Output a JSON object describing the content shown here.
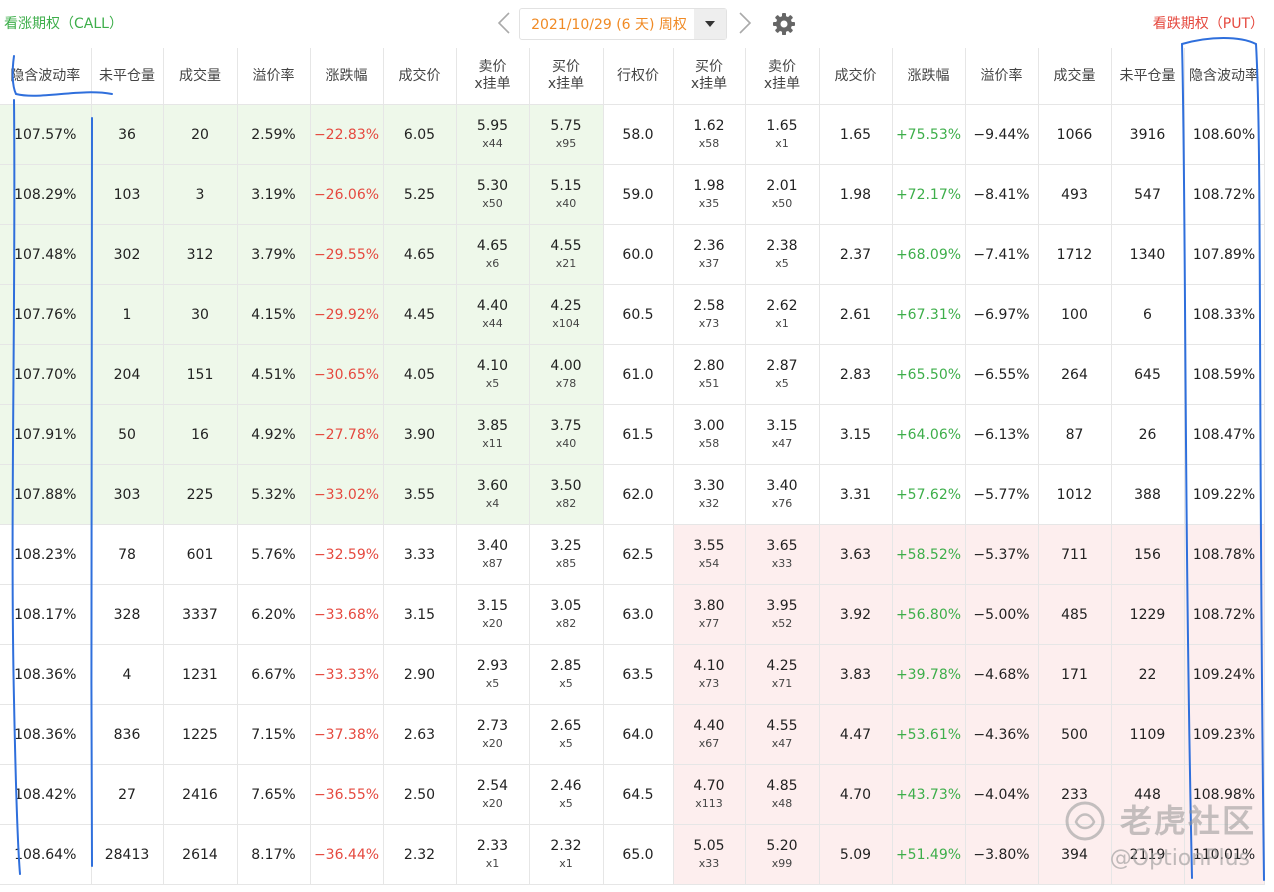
{
  "call_title": "看涨期权（CALL）",
  "put_title": "看跌期权（PUT）",
  "expiry": {
    "selected": "2021/10/29 (6 天) 周权"
  },
  "headers": [
    "隐含波动率",
    "未平仓量",
    "成交量",
    "溢价率",
    "涨跌幅",
    "成交价",
    "卖价\nx挂单",
    "买价\nx挂单",
    "行权价",
    "买价\nx挂单",
    "卖价\nx挂单",
    "成交价",
    "涨跌幅",
    "溢价率",
    "成交量",
    "未平仓量",
    "隐含波动率"
  ],
  "rows": [
    {
      "c_iv": "107.57%",
      "c_oi": "36",
      "c_vol": "20",
      "c_prem": "2.59%",
      "c_chg": "−22.83%",
      "c_last": "6.05",
      "c_ask": "5.95",
      "c_askq": "x44",
      "c_bid": "5.75",
      "c_bidq": "x95",
      "strike": "58.0",
      "p_bid": "1.62",
      "p_bidq": "x58",
      "p_ask": "1.65",
      "p_askq": "x1",
      "p_last": "1.65",
      "p_chg": "+75.53%",
      "p_prem": "−9.44%",
      "p_vol": "1066",
      "p_oi": "3916",
      "p_iv": "108.60%",
      "call_itm": true,
      "put_itm": false
    },
    {
      "c_iv": "108.29%",
      "c_oi": "103",
      "c_vol": "3",
      "c_prem": "3.19%",
      "c_chg": "−26.06%",
      "c_last": "5.25",
      "c_ask": "5.30",
      "c_askq": "x50",
      "c_bid": "5.15",
      "c_bidq": "x40",
      "strike": "59.0",
      "p_bid": "1.98",
      "p_bidq": "x35",
      "p_ask": "2.01",
      "p_askq": "x50",
      "p_last": "1.98",
      "p_chg": "+72.17%",
      "p_prem": "−8.41%",
      "p_vol": "493",
      "p_oi": "547",
      "p_iv": "108.72%",
      "call_itm": true,
      "put_itm": false
    },
    {
      "c_iv": "107.48%",
      "c_oi": "302",
      "c_vol": "312",
      "c_prem": "3.79%",
      "c_chg": "−29.55%",
      "c_last": "4.65",
      "c_ask": "4.65",
      "c_askq": "x6",
      "c_bid": "4.55",
      "c_bidq": "x21",
      "strike": "60.0",
      "p_bid": "2.36",
      "p_bidq": "x37",
      "p_ask": "2.38",
      "p_askq": "x5",
      "p_last": "2.37",
      "p_chg": "+68.09%",
      "p_prem": "−7.41%",
      "p_vol": "1712",
      "p_oi": "1340",
      "p_iv": "107.89%",
      "call_itm": true,
      "put_itm": false
    },
    {
      "c_iv": "107.76%",
      "c_oi": "1",
      "c_vol": "30",
      "c_prem": "4.15%",
      "c_chg": "−29.92%",
      "c_last": "4.45",
      "c_ask": "4.40",
      "c_askq": "x44",
      "c_bid": "4.25",
      "c_bidq": "x104",
      "strike": "60.5",
      "p_bid": "2.58",
      "p_bidq": "x73",
      "p_ask": "2.62",
      "p_askq": "x1",
      "p_last": "2.61",
      "p_chg": "+67.31%",
      "p_prem": "−6.97%",
      "p_vol": "100",
      "p_oi": "6",
      "p_iv": "108.33%",
      "call_itm": true,
      "put_itm": false
    },
    {
      "c_iv": "107.70%",
      "c_oi": "204",
      "c_vol": "151",
      "c_prem": "4.51%",
      "c_chg": "−30.65%",
      "c_last": "4.05",
      "c_ask": "4.10",
      "c_askq": "x5",
      "c_bid": "4.00",
      "c_bidq": "x78",
      "strike": "61.0",
      "p_bid": "2.80",
      "p_bidq": "x51",
      "p_ask": "2.87",
      "p_askq": "x5",
      "p_last": "2.83",
      "p_chg": "+65.50%",
      "p_prem": "−6.55%",
      "p_vol": "264",
      "p_oi": "645",
      "p_iv": "108.59%",
      "call_itm": true,
      "put_itm": false
    },
    {
      "c_iv": "107.91%",
      "c_oi": "50",
      "c_vol": "16",
      "c_prem": "4.92%",
      "c_chg": "−27.78%",
      "c_last": "3.90",
      "c_ask": "3.85",
      "c_askq": "x11",
      "c_bid": "3.75",
      "c_bidq": "x40",
      "strike": "61.5",
      "p_bid": "3.00",
      "p_bidq": "x58",
      "p_ask": "3.15",
      "p_askq": "x47",
      "p_last": "3.15",
      "p_chg": "+64.06%",
      "p_prem": "−6.13%",
      "p_vol": "87",
      "p_oi": "26",
      "p_iv": "108.47%",
      "call_itm": true,
      "put_itm": false
    },
    {
      "c_iv": "107.88%",
      "c_oi": "303",
      "c_vol": "225",
      "c_prem": "5.32%",
      "c_chg": "−33.02%",
      "c_last": "3.55",
      "c_ask": "3.60",
      "c_askq": "x4",
      "c_bid": "3.50",
      "c_bidq": "x82",
      "strike": "62.0",
      "p_bid": "3.30",
      "p_bidq": "x32",
      "p_ask": "3.40",
      "p_askq": "x76",
      "p_last": "3.31",
      "p_chg": "+57.62%",
      "p_prem": "−5.77%",
      "p_vol": "1012",
      "p_oi": "388",
      "p_iv": "109.22%",
      "call_itm": true,
      "put_itm": false
    },
    {
      "c_iv": "108.23%",
      "c_oi": "78",
      "c_vol": "601",
      "c_prem": "5.76%",
      "c_chg": "−32.59%",
      "c_last": "3.33",
      "c_ask": "3.40",
      "c_askq": "x87",
      "c_bid": "3.25",
      "c_bidq": "x85",
      "strike": "62.5",
      "p_bid": "3.55",
      "p_bidq": "x54",
      "p_ask": "3.65",
      "p_askq": "x33",
      "p_last": "3.63",
      "p_chg": "+58.52%",
      "p_prem": "−5.37%",
      "p_vol": "711",
      "p_oi": "156",
      "p_iv": "108.78%",
      "call_itm": false,
      "put_itm": true
    },
    {
      "c_iv": "108.17%",
      "c_oi": "328",
      "c_vol": "3337",
      "c_prem": "6.20%",
      "c_chg": "−33.68%",
      "c_last": "3.15",
      "c_ask": "3.15",
      "c_askq": "x20",
      "c_bid": "3.05",
      "c_bidq": "x82",
      "strike": "63.0",
      "p_bid": "3.80",
      "p_bidq": "x77",
      "p_ask": "3.95",
      "p_askq": "x52",
      "p_last": "3.92",
      "p_chg": "+56.80%",
      "p_prem": "−5.00%",
      "p_vol": "485",
      "p_oi": "1229",
      "p_iv": "108.72%",
      "call_itm": false,
      "put_itm": true
    },
    {
      "c_iv": "108.36%",
      "c_oi": "4",
      "c_vol": "1231",
      "c_prem": "6.67%",
      "c_chg": "−33.33%",
      "c_last": "2.90",
      "c_ask": "2.93",
      "c_askq": "x5",
      "c_bid": "2.85",
      "c_bidq": "x5",
      "strike": "63.5",
      "p_bid": "4.10",
      "p_bidq": "x73",
      "p_ask": "4.25",
      "p_askq": "x71",
      "p_last": "3.83",
      "p_chg": "+39.78%",
      "p_prem": "−4.68%",
      "p_vol": "171",
      "p_oi": "22",
      "p_iv": "109.24%",
      "call_itm": false,
      "put_itm": true
    },
    {
      "c_iv": "108.36%",
      "c_oi": "836",
      "c_vol": "1225",
      "c_prem": "7.15%",
      "c_chg": "−37.38%",
      "c_last": "2.63",
      "c_ask": "2.73",
      "c_askq": "x20",
      "c_bid": "2.65",
      "c_bidq": "x5",
      "strike": "64.0",
      "p_bid": "4.40",
      "p_bidq": "x67",
      "p_ask": "4.55",
      "p_askq": "x47",
      "p_last": "4.47",
      "p_chg": "+53.61%",
      "p_prem": "−4.36%",
      "p_vol": "500",
      "p_oi": "1109",
      "p_iv": "109.23%",
      "call_itm": false,
      "put_itm": true
    },
    {
      "c_iv": "108.42%",
      "c_oi": "27",
      "c_vol": "2416",
      "c_prem": "7.65%",
      "c_chg": "−36.55%",
      "c_last": "2.50",
      "c_ask": "2.54",
      "c_askq": "x20",
      "c_bid": "2.46",
      "c_bidq": "x5",
      "strike": "64.5",
      "p_bid": "4.70",
      "p_bidq": "x113",
      "p_ask": "4.85",
      "p_askq": "x48",
      "p_last": "4.70",
      "p_chg": "+43.73%",
      "p_prem": "−4.04%",
      "p_vol": "233",
      "p_oi": "448",
      "p_iv": "108.98%",
      "call_itm": false,
      "put_itm": true
    },
    {
      "c_iv": "108.64%",
      "c_oi": "28413",
      "c_vol": "2614",
      "c_prem": "8.17%",
      "c_chg": "−36.44%",
      "c_last": "2.32",
      "c_ask": "2.33",
      "c_askq": "x1",
      "c_bid": "2.32",
      "c_bidq": "x1",
      "strike": "65.0",
      "p_bid": "5.05",
      "p_bidq": "x33",
      "p_ask": "5.20",
      "p_askq": "x99",
      "p_last": "5.09",
      "p_chg": "+51.49%",
      "p_prem": "−3.80%",
      "p_vol": "394",
      "p_oi": "2119",
      "p_iv": "110.01%",
      "call_itm": false,
      "put_itm": true
    }
  ],
  "watermark": {
    "brand": "老虎社区",
    "handle": "@OptionPlus"
  },
  "icons": {
    "prev": "chevron-left-icon",
    "next": "chevron-right-icon",
    "caret": "caret-down-icon",
    "settings": "gear-icon",
    "watermark": "tiger-logo-icon"
  },
  "colors": {
    "call": "#3dae4a",
    "put": "#e5493f",
    "accent": "#f08a24",
    "call_itm_bg": "#eef8ea",
    "put_itm_bg": "#fdeeee",
    "annotation": "#2f6fdc"
  }
}
